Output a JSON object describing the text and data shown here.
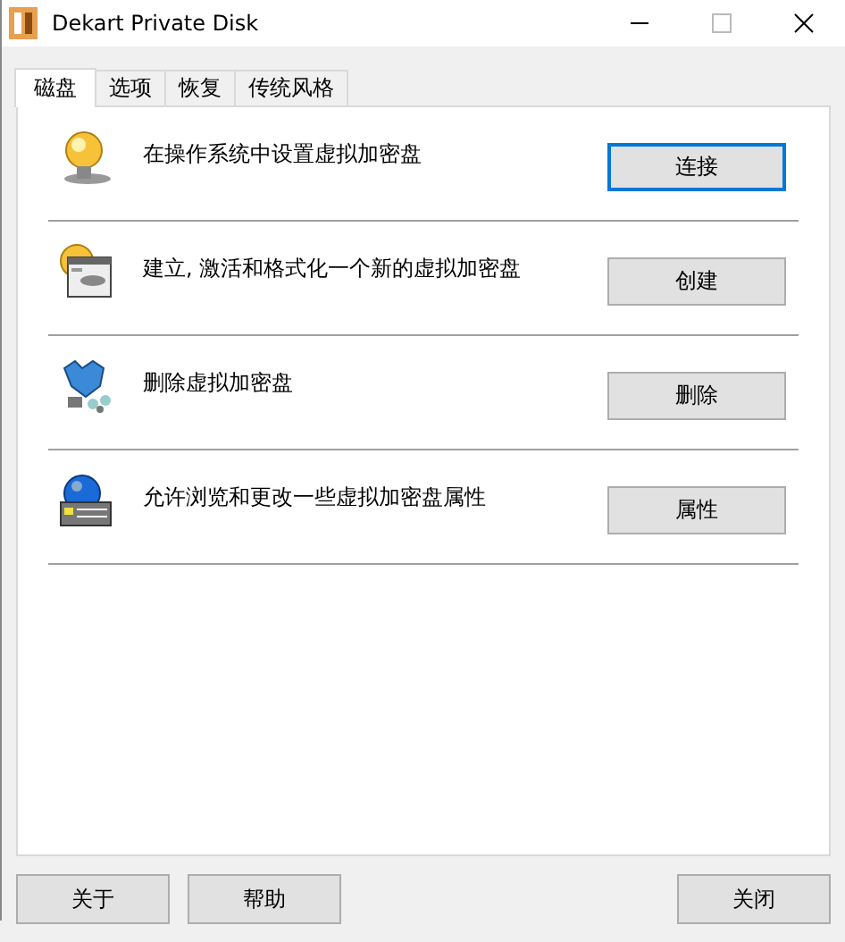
{
  "window": {
    "title": "Dekart Private Disk"
  },
  "tabs": [
    {
      "label": "磁盘",
      "selected": true
    },
    {
      "label": "选项",
      "selected": false
    },
    {
      "label": "恢复",
      "selected": false
    },
    {
      "label": "传统风格",
      "selected": false
    }
  ],
  "actions": [
    {
      "kind": "bulb",
      "description": "在操作系统中设置虚拟加密盘",
      "button": "连接",
      "default": true
    },
    {
      "kind": "bulb-window",
      "description": "建立, 激活和格式化一个新的虚拟加密盘",
      "button": "创建",
      "default": false
    },
    {
      "kind": "broken-bulb",
      "description": "删除虚拟加密盘",
      "button": "删除",
      "default": false
    },
    {
      "kind": "globe-panel",
      "description": "允许浏览和更改一些虚拟加密盘属性",
      "button": "属性",
      "default": false
    }
  ],
  "footer_buttons": [
    {
      "label": "关于"
    },
    {
      "label": "帮助"
    },
    {
      "label": "关闭"
    }
  ]
}
